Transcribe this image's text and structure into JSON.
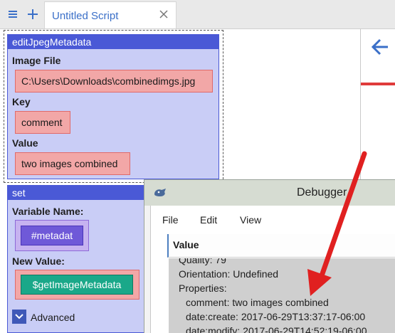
{
  "tab": {
    "title": "Untitled Script"
  },
  "editBlock": {
    "title": "editJpegMetadata",
    "imageFileLabel": "Image File",
    "imageFileValue": "C:\\Users\\Downloads\\combinedimgs.jpg",
    "keyLabel": "Key",
    "keyValue": "comment",
    "valueLabel": "Value",
    "valueValue": "two images combined"
  },
  "setBlock": {
    "title": "set",
    "varNameLabel": "Variable Name:",
    "varNameValue": "#metadat",
    "newValueLabel": "New Value:",
    "newValueValue": "$getImageMetadata",
    "advancedLabel": "Advanced"
  },
  "debugger": {
    "title": "Debugger",
    "menu": [
      "File",
      "Edit",
      "View"
    ],
    "columnHeader": "Value",
    "lines": [
      "Quality: 79",
      "Orientation: Undefined",
      "Properties:",
      "  comment: two images combined",
      "  date:create: 2017-06-29T13:37:17-06:00",
      "  date:modify: 2017-06-29T14:52:19-06:00"
    ]
  },
  "colors": {
    "accent": "#3a6fc8",
    "blockHeader": "#4a59d6",
    "blockBody": "#c9cdf6",
    "inputRed": "#f2a7a7",
    "variablePurple": "#6f59d8",
    "functionGreen": "#1aa889",
    "annotationArrow": "#e02020"
  },
  "icons": {
    "menu": "hamburger-icon",
    "add": "plus-icon",
    "close": "close-icon",
    "back": "arrow-left-icon",
    "advanced": "chevron-down-icon",
    "debuggerLogo": "debugger-logo-icon"
  }
}
